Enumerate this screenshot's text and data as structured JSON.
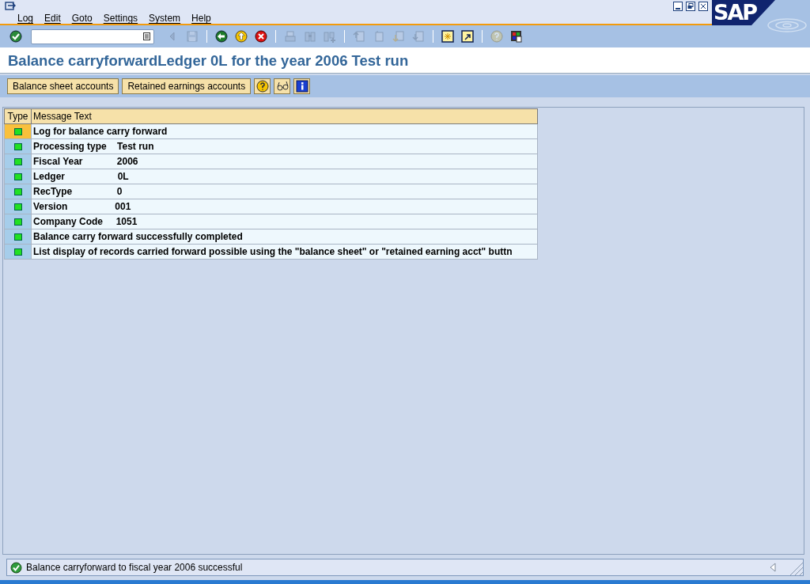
{
  "menu": [
    "Log",
    "Edit",
    "Goto",
    "Settings",
    "System",
    "Help"
  ],
  "toolbar": [
    {
      "kind": "enter",
      "disabled": false
    },
    {
      "kind": "command-field"
    },
    {
      "kind": "back-small",
      "disabled": true
    },
    {
      "kind": "save",
      "disabled": true
    },
    {
      "kind": "sep"
    },
    {
      "kind": "back",
      "disabled": false
    },
    {
      "kind": "exit",
      "disabled": false
    },
    {
      "kind": "cancel",
      "disabled": false
    },
    {
      "kind": "sep"
    },
    {
      "kind": "print",
      "disabled": true
    },
    {
      "kind": "find",
      "disabled": true
    },
    {
      "kind": "find-next",
      "disabled": true
    },
    {
      "kind": "sep"
    },
    {
      "kind": "first-page",
      "disabled": true
    },
    {
      "kind": "prev-page",
      "disabled": true
    },
    {
      "kind": "next-page",
      "disabled": true
    },
    {
      "kind": "last-page",
      "disabled": true
    },
    {
      "kind": "sep"
    },
    {
      "kind": "new-session",
      "disabled": false
    },
    {
      "kind": "shortcut",
      "disabled": false
    },
    {
      "kind": "sep"
    },
    {
      "kind": "help",
      "disabled": true
    },
    {
      "kind": "layout",
      "disabled": false
    }
  ],
  "logo": "SAP",
  "title": "Balance carryforwardLedger 0L for the year 2006 Test run",
  "app_toolbar": [
    {
      "kind": "text",
      "label": "Balance sheet accounts"
    },
    {
      "kind": "text",
      "label": "Retained earnings accounts"
    },
    {
      "kind": "help"
    },
    {
      "kind": "glasses"
    },
    {
      "kind": "info"
    }
  ],
  "table": {
    "columns": [
      "Type",
      "Message Text"
    ],
    "rows": [
      {
        "text": "Log for balance carry forward",
        "selected": true
      },
      {
        "text": "Processing type    Test run",
        "selected": false
      },
      {
        "text": "Fiscal Year             2006",
        "selected": false
      },
      {
        "text": "Ledger                    0L",
        "selected": false
      },
      {
        "text": "RecType                 0",
        "selected": false
      },
      {
        "text": "Version                  001",
        "selected": false
      },
      {
        "text": "Company Code     1051",
        "selected": false
      },
      {
        "text": "Balance carry forward successfully completed",
        "selected": false
      },
      {
        "text": "List display of records carried forward possible using the \"balance sheet\" or \"retained earning acct\" buttn",
        "selected": false
      }
    ]
  },
  "status_bar": {
    "text": "Balance carryforward to fiscal year 2006 successful"
  }
}
